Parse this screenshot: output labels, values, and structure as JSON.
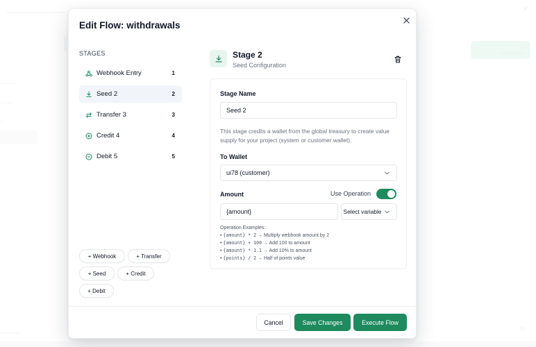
{
  "modal": {
    "title": "Edit Flow: withdrawals",
    "close_icon": "close-icon"
  },
  "stages": {
    "heading": "STAGES",
    "items": [
      {
        "label": "Webhook Entry",
        "num": "1",
        "icon": "webhook-icon"
      },
      {
        "label": "Seed 2",
        "num": "2",
        "icon": "download-icon",
        "active": true
      },
      {
        "label": "Transfer 3",
        "num": "3",
        "icon": "transfer-icon"
      },
      {
        "label": "Credit 4",
        "num": "4",
        "icon": "plus-circle-icon"
      },
      {
        "label": "Debit 5",
        "num": "5",
        "icon": "minus-circle-icon"
      }
    ]
  },
  "add_buttons": {
    "webhook": "+ Webhook",
    "transfer": "+ Transfer",
    "seed": "+ Seed",
    "credit": "+ Credit",
    "debit": "+ Debit"
  },
  "detail": {
    "title": "Stage 2",
    "subtitle": "Seed Configuration",
    "stage_name_label": "Stage Name",
    "stage_name_value": "Seed 2",
    "description": "This stage credits a wallet from the global treasury to create value supply for your project (system or customer wallet).",
    "to_wallet_label": "To Wallet",
    "to_wallet_value": "ui78 (customer)",
    "amount_label": "Amount",
    "use_operation_label": "Use Operation",
    "use_operation_on": true,
    "amount_value": "{amount}",
    "select_variable": "Select variable",
    "examples_heading": "Operation Examples:",
    "examples": [
      {
        "code": "{amount} * 2",
        "text": "→ Multiply webhook amount by 2"
      },
      {
        "code": "{amount} + 100",
        "text": "→ Add 100 to amount"
      },
      {
        "code": "{amount} * 1.1",
        "text": "→ Add 10% to amount"
      },
      {
        "code": "{points} / 2",
        "text": "→ Half of points value"
      }
    ]
  },
  "footer": {
    "cancel": "Cancel",
    "save": "Save Changes",
    "execute": "Execute Flow"
  },
  "colors": {
    "accent": "#1e8a5e",
    "accent_soft": "#e7f5ee"
  }
}
